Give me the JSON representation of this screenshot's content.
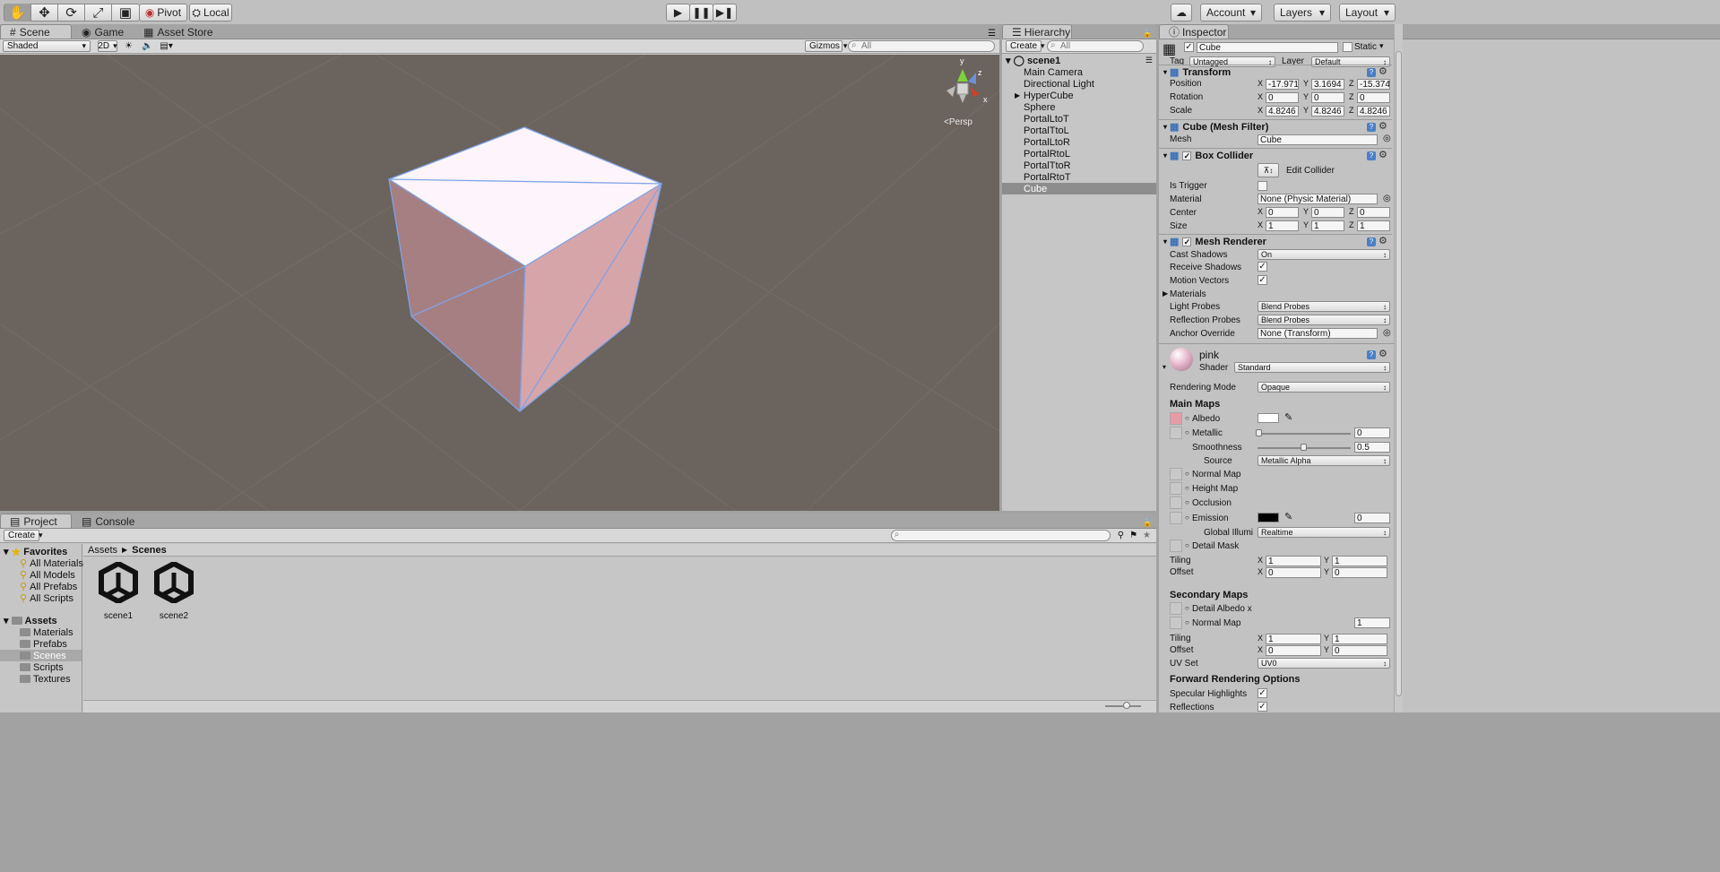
{
  "toolbar": {
    "pivot": "Pivot",
    "local": "Local",
    "account": "Account",
    "layers": "Layers",
    "layout": "Layout"
  },
  "scene": {
    "tabs": [
      "Scene",
      "Game",
      "Asset Store"
    ],
    "shading": "Shaded",
    "mode_2d": "2D",
    "gizmos": "Gizmos",
    "search_placeholder": "All",
    "persp": "Persp",
    "axis_y": "y",
    "axis_z": "z",
    "axis_x": "x"
  },
  "hierarchy": {
    "tab": "Hierarchy",
    "create": "Create",
    "search_placeholder": "All",
    "scene": "scene1",
    "items": [
      "Main Camera",
      "Directional Light",
      "HyperCube",
      "Sphere",
      "PortalLtoT",
      "PortalTtoL",
      "PortalLtoR",
      "PortalRtoL",
      "PortalTtoR",
      "PortalRtoT",
      "Cube"
    ],
    "selected": "Cube"
  },
  "project": {
    "tabs": [
      "Project",
      "Console"
    ],
    "create": "Create",
    "favorites": "Favorites",
    "fav_items": [
      "All Materials",
      "All Models",
      "All Prefabs",
      "All Scripts"
    ],
    "assets": "Assets",
    "asset_folders": [
      "Materials",
      "Prefabs",
      "Scenes",
      "Scripts",
      "Textures"
    ],
    "breadcrumb_root": "Assets",
    "breadcrumb_current": "Scenes",
    "files": [
      "scene1",
      "scene2"
    ]
  },
  "inspector": {
    "tab": "Inspector",
    "name": "Cube",
    "static": "Static",
    "tag_label": "Tag",
    "tag": "Untagged",
    "layer_label": "Layer",
    "layer": "Default",
    "transform": {
      "title": "Transform",
      "position_label": "Position",
      "position": [
        "-17.971",
        "3.1694",
        "-15.374"
      ],
      "rotation_label": "Rotation",
      "rotation": [
        "0",
        "0",
        "0"
      ],
      "scale_label": "Scale",
      "scale": [
        "4.8246",
        "4.8246",
        "4.8246"
      ]
    },
    "mesh_filter": {
      "title": "Cube (Mesh Filter)",
      "mesh_label": "Mesh",
      "mesh": "Cube"
    },
    "box_collider": {
      "title": "Box Collider",
      "edit": "Edit Collider",
      "is_trigger_label": "Is Trigger",
      "material_label": "Material",
      "material": "None (Physic Material)",
      "center_label": "Center",
      "center": [
        "0",
        "0",
        "0"
      ],
      "size_label": "Size",
      "size": [
        "1",
        "1",
        "1"
      ]
    },
    "mesh_renderer": {
      "title": "Mesh Renderer",
      "cast_label": "Cast Shadows",
      "cast": "On",
      "receive_label": "Receive Shadows",
      "motion_label": "Motion Vectors",
      "materials_label": "Materials",
      "light_label": "Light Probes",
      "light": "Blend Probes",
      "reflection_label": "Reflection Probes",
      "reflection": "Blend Probes",
      "anchor_label": "Anchor Override",
      "anchor": "None (Transform)"
    },
    "material": {
      "name": "pink",
      "shader_label": "Shader",
      "shader": "Standard",
      "rendering_label": "Rendering Mode",
      "rendering": "Opaque",
      "main_maps": "Main Maps",
      "albedo": "Albedo",
      "metallic": "Metallic",
      "metallic_value": "0",
      "smoothness": "Smoothness",
      "smoothness_value": "0.5",
      "source_label": "Source",
      "source": "Metallic Alpha",
      "normal_map": "Normal Map",
      "height_map": "Height Map",
      "occlusion": "Occlusion",
      "emission": "Emission",
      "emission_value": "0",
      "global_illum": "Global Illumi",
      "global_illum_value": "Realtime",
      "detail_mask": "Detail Mask",
      "tiling_label": "Tiling",
      "tiling": [
        "1",
        "1"
      ],
      "offset_label": "Offset",
      "offset": [
        "0",
        "0"
      ],
      "secondary_maps": "Secondary Maps",
      "detail_albedo": "Detail Albedo x",
      "normal_map2": "Normal Map",
      "normal_map2_value": "1",
      "tiling2": [
        "1",
        "1"
      ],
      "offset2": [
        "0",
        "0"
      ],
      "uv_label": "UV Set",
      "uv": "UV0",
      "forward": "Forward Rendering Options",
      "specular": "Specular Highlights",
      "reflections": "Reflections"
    }
  },
  "colors": {
    "cube_top": "#fef5fc",
    "cube_left": "#a67f83",
    "cube_right": "#d6a5aa",
    "edge": "#7fa3e6",
    "albedo": "#e89aa6",
    "viewport": "#6a635e"
  }
}
